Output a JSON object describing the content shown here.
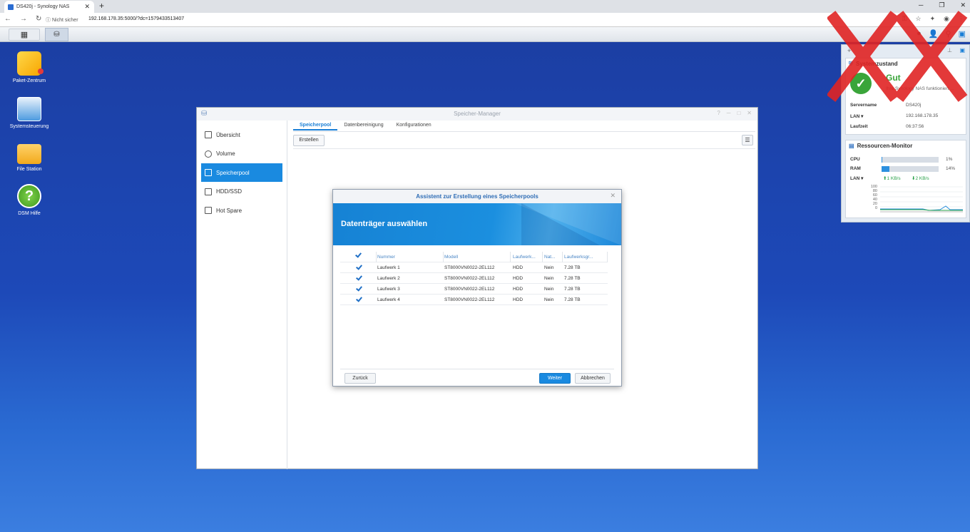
{
  "browser": {
    "tab_title": "DS420j - Synology NAS",
    "security": "Nicht sicher",
    "url": "192.168.178.35:5000/?dc=1579433513407"
  },
  "desktop": {
    "icons": [
      {
        "label": "Paket-Zentrum",
        "icon": "package-center-icon"
      },
      {
        "label": "Systemsteuerung",
        "icon": "control-panel-icon"
      },
      {
        "label": "File Station",
        "icon": "folder-icon"
      },
      {
        "label": "DSM Hilfe",
        "icon": "help-icon"
      }
    ]
  },
  "window": {
    "title": "Speicher-Manager",
    "sidebar": [
      {
        "label": "Übersicht",
        "active": false
      },
      {
        "label": "Volume",
        "active": false
      },
      {
        "label": "Speicherpool",
        "active": true
      },
      {
        "label": "HDD/SSD",
        "active": false
      },
      {
        "label": "Hot Spare",
        "active": false
      }
    ],
    "tabs": [
      "Speicherpool",
      "Datenbereinigung",
      "Konfigurationen"
    ],
    "create_label": "Erstellen"
  },
  "dialog": {
    "title": "Assistent zur Erstellung eines Speicherpools",
    "heading": "Datenträger auswählen",
    "columns": [
      "Nummer",
      "Modell",
      "Laufwerk...",
      "Nat...",
      "Laufwerksgr..."
    ],
    "rows": [
      {
        "checked": true,
        "number": "Laufwerk 1",
        "model": "ST8000VN0022-2EL112",
        "type": "HDD",
        "native": "Nein",
        "size": "7.28 TB"
      },
      {
        "checked": true,
        "number": "Laufwerk 2",
        "model": "ST8000VN0022-2EL112",
        "type": "HDD",
        "native": "Nein",
        "size": "7.28 TB"
      },
      {
        "checked": true,
        "number": "Laufwerk 3",
        "model": "ST8000VN0022-2EL112",
        "type": "HDD",
        "native": "Nein",
        "size": "7.28 TB"
      },
      {
        "checked": true,
        "number": "Laufwerk 4",
        "model": "ST8000VN0022-2EL112",
        "type": "HDD",
        "native": "Nein",
        "size": "7.28 TB"
      }
    ],
    "back_label": "Zurück",
    "next_label": "Weiter",
    "cancel_label": "Abbrechen"
  },
  "widgets": {
    "health": {
      "title": "Systemzustand",
      "status": "Gut",
      "message": "Ihre Synology NAS funktioniert ...",
      "servername_label": "Servername",
      "servername": "DS420j",
      "lan_label": "LAN",
      "lan": "192.168.178.35",
      "uptime_label": "Laufzeit",
      "uptime": "06:37:56"
    },
    "resources": {
      "title": "Ressourcen-Monitor",
      "cpu_label": "CPU",
      "cpu": "1%",
      "cpu_fraction": 0.01,
      "ram_label": "RAM",
      "ram": "14%",
      "ram_fraction": 0.14,
      "lan_label": "LAN",
      "upload": "1 KB/s",
      "download": "2 KB/s",
      "y_ticks": [
        "100",
        "80",
        "60",
        "40",
        "20",
        "0"
      ]
    }
  }
}
